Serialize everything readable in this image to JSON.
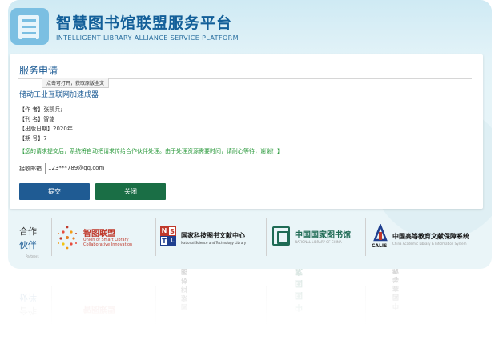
{
  "header": {
    "title": "智慧图书馆联盟服务平台",
    "subtitle": "INTELLIGENT LIBRARY ALLIANCE SERVICE PLATFORM"
  },
  "panel": {
    "title": "服务申请",
    "tooltip": "点击可打开，获取原版全文",
    "resource_title": "储动工业互联网加速成器",
    "meta": [
      {
        "label": "【作 者】",
        "value": "张凯兵;"
      },
      {
        "label": "【刊 名】",
        "value": "智能"
      },
      {
        "label": "【出版日期】",
        "value": "2020年"
      },
      {
        "label": "【期 号】",
        "value": "7"
      }
    ],
    "notice": "【您的请求提交后，系统将自动把请求传给合作伙伴处理。由于处理资源需要时间，请耐心等待，谢谢！】",
    "email_label": "接收邮箱",
    "email_value": "123***789@qq.com",
    "submit_label": "提交",
    "close_label": "关闭"
  },
  "partners": {
    "label_line1": "合作",
    "label_line2": "伙伴",
    "caption": "Partners",
    "items": [
      {
        "name": "智图联盟",
        "sub_line1": "Union of Smart Library",
        "sub_line2": "Collaborative Innovation"
      },
      {
        "name": "国家科技图书文献中心",
        "sub": "National Science and Technology Library",
        "mark": [
          "N",
          "S",
          "T",
          "L"
        ]
      },
      {
        "name": "中国国家图书馆",
        "sub": "NATIONAL LIBRARY OF CHINA"
      },
      {
        "name": "中国高等教育文献保障系统",
        "sub": "China Academic Library & Information System",
        "mark": "CALIS"
      }
    ]
  },
  "colors": {
    "brand_blue": "#1a5a94",
    "submit_button": "#1f5b93",
    "close_button": "#1a6e45",
    "notice_green": "#2b9a3c"
  },
  "icons": {
    "logo": "book-pages-icon",
    "watermark": "arrow-down-icon"
  }
}
